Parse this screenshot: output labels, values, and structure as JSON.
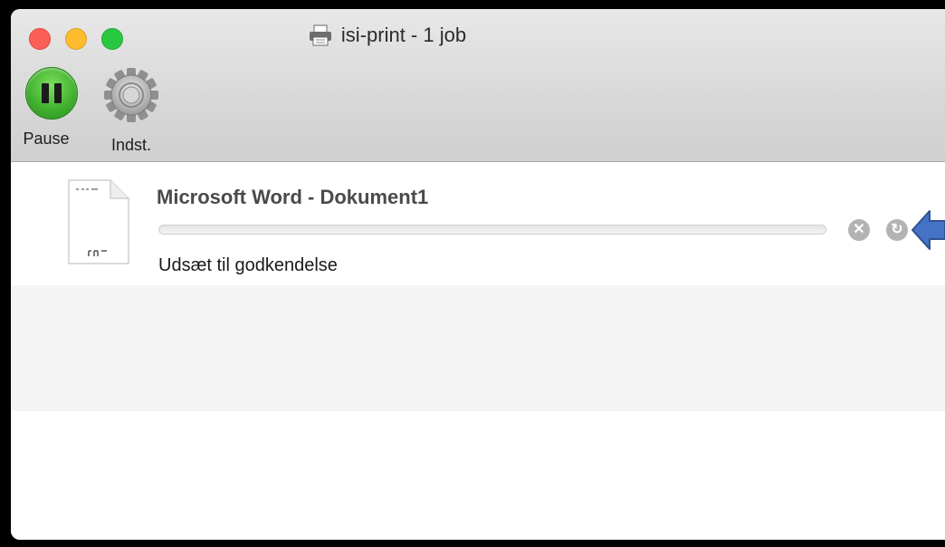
{
  "window": {
    "title": "isi-print - 1 job",
    "title_icon": "printer-icon"
  },
  "toolbar": {
    "pause_label": "Pause",
    "settings_label": "Indst."
  },
  "jobs": [
    {
      "name": "Microsoft Word - Dokument1",
      "status": "Udsæt til godkendelse",
      "progress": 0
    }
  ],
  "colors": {
    "close": "#fc5f57",
    "minimize": "#fdbc2e",
    "zoom": "#2ac840",
    "pause_green": "#3fae2d",
    "callout_arrow": "#4472c4"
  }
}
